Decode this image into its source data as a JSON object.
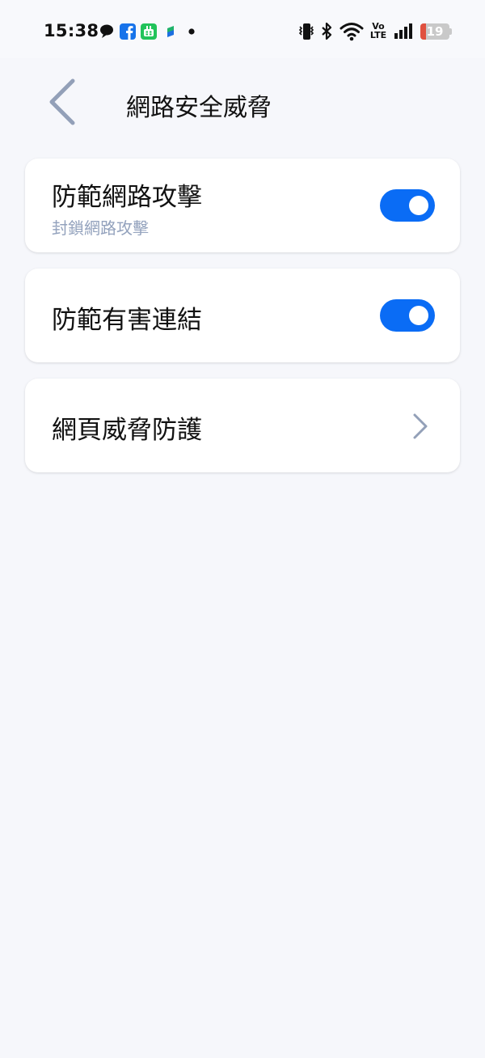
{
  "status_bar": {
    "time": "15:38",
    "battery_level": "19",
    "battery_fraction": 0.19,
    "notification_icons": [
      "chat-bubble-icon",
      "facebook-icon",
      "wechat-icon",
      "vpn-icon",
      "dot-icon"
    ],
    "system_icons": [
      "vibrate-icon",
      "bluetooth-icon",
      "wifi-icon",
      "volte-icon",
      "signal-icon",
      "battery-icon"
    ],
    "volte_top": "Vo",
    "volte_bottom": "LTE"
  },
  "header": {
    "back_icon": "chevron-left-icon",
    "title": "網路安全威脅"
  },
  "settings": {
    "items": [
      {
        "title": "防範網路攻擊",
        "subtitle": "封鎖網路攻擊",
        "control": "toggle",
        "enabled": true
      },
      {
        "title": "防範有害連結",
        "control": "toggle",
        "enabled": true
      },
      {
        "title": "網頁威脅防護",
        "control": "chevron-right-icon"
      }
    ]
  },
  "colors": {
    "accent": "#0a6cf5",
    "background": "#f6f7fb",
    "subtitle": "#93a2bd",
    "icon_gray": "#93a0b8",
    "battery_low": "#e0503f"
  }
}
